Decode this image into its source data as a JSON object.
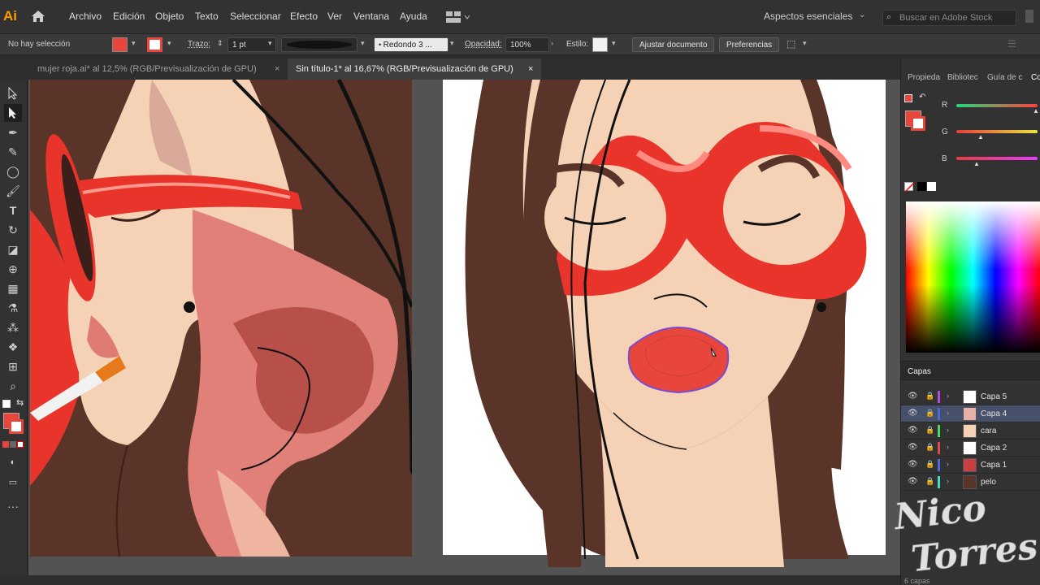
{
  "app": {
    "logo": "Ai"
  },
  "menu": [
    "Archivo",
    "Edición",
    "Objeto",
    "Texto",
    "Seleccionar",
    "Efecto",
    "Ver",
    "Ventana",
    "Ayuda"
  ],
  "workspace": "Aspectos esenciales",
  "search_placeholder": "Buscar en Adobe Stock",
  "control": {
    "selection": "No hay selección",
    "stroke_label": "Trazo:",
    "stroke_weight": "1 pt",
    "brush": "Redondo 3 ...",
    "opacity_label": "Opacidad:",
    "opacity_value": "100%",
    "style_label": "Estilo:",
    "adjust_document": "Ajustar documento",
    "preferences": "Preferencias"
  },
  "tabs": [
    {
      "label": "mujer roja.ai* al 12,5% (RGB/Previsualización de GPU)",
      "active": false
    },
    {
      "label": "Sin título-1* al 16,67% (RGB/Previsualización de GPU)",
      "active": true
    }
  ],
  "panel_tabs": [
    "Propieda",
    "Bibliotec",
    "Guía de c",
    "Co"
  ],
  "color": {
    "channels": [
      {
        "label": "R",
        "level": 0.98
      },
      {
        "label": "G",
        "level": 0.3
      },
      {
        "label": "B",
        "level": 0.25
      }
    ],
    "fill_color": "#e8453c"
  },
  "layers": {
    "title": "Capas",
    "items": [
      {
        "name": "Capa 5",
        "color": "#b04dde",
        "selected": false
      },
      {
        "name": "Capa 4",
        "color": "#4c6bd8",
        "selected": true
      },
      {
        "name": "cara",
        "color": "#4cd868",
        "selected": false
      },
      {
        "name": "Capa 2",
        "color": "#d84c4c",
        "selected": false
      },
      {
        "name": "Capa 1",
        "color": "#4c6bd8",
        "selected": false
      },
      {
        "name": "pelo",
        "color": "#4cd8c8",
        "selected": false
      }
    ],
    "count": "6 capas"
  },
  "watermark": {
    "line1": "Nico",
    "line2": "Torres"
  },
  "colors": {
    "hair": "#5a3429",
    "skin": "#f5d2b5",
    "red": "#e8342b",
    "shadow": "#e59a8c"
  }
}
